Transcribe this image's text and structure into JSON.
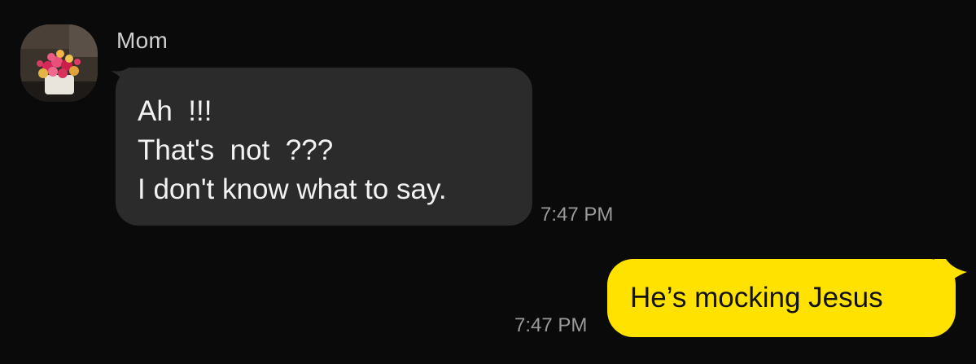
{
  "conversation": {
    "incoming": {
      "sender_name": "Mom",
      "avatar_icon": "flower-bouquet-photo",
      "lines": [
        "Ah  !!!",
        "That's  not  ???",
        "I don't know what to say."
      ],
      "timestamp": "7:47 PM",
      "bubble_color": "#2b2b2b"
    },
    "outgoing": {
      "text": "He’s mocking Jesus",
      "timestamp": "7:47 PM",
      "bubble_color": "#ffe200"
    }
  },
  "theme": {
    "background": "#0a0a0a",
    "text_incoming": "#f2f2f2",
    "text_outgoing": "#111111",
    "timestamp_color": "#9a9a9a"
  }
}
